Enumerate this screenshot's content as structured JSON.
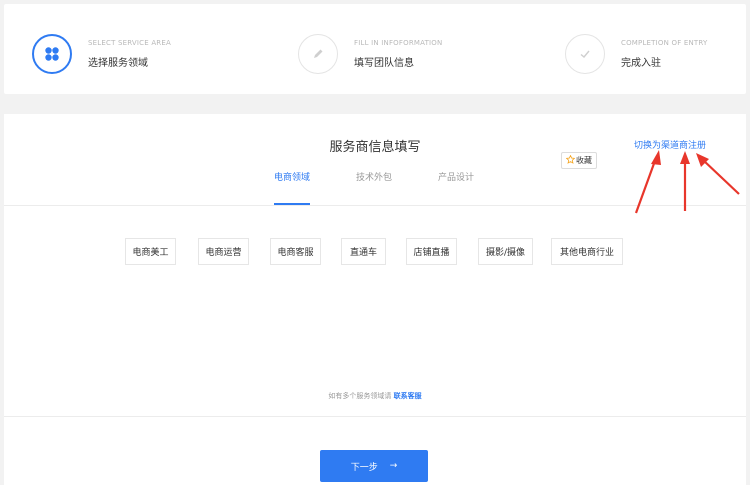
{
  "stepper": {
    "steps": [
      {
        "en": "SELECT SERVICE AREA",
        "zh": "选择服务领域",
        "icon": "grid-icon",
        "state": "active"
      },
      {
        "en": "FILL IN INFOFORMATION",
        "zh": "填写团队信息",
        "icon": "pencil-icon",
        "state": "pending"
      },
      {
        "en": "COMPLETION OF ENTRY",
        "zh": "完成入驻",
        "icon": "check-icon",
        "state": "pending"
      }
    ]
  },
  "form": {
    "title": "服务商信息填写",
    "channel_link": "切换为渠道商注册",
    "favorite_label": "收藏",
    "tabs": [
      {
        "label": "电商领域",
        "active": true
      },
      {
        "label": "技术外包",
        "active": false
      },
      {
        "label": "产品设计",
        "active": false
      }
    ],
    "categories": [
      "电商美工",
      "电商运营",
      "电商客服",
      "直通车",
      "店铺直播",
      "摄影/摄像",
      "其他电商行业"
    ],
    "hint_text": "如有多个服务领域请",
    "hint_link": "联系客服",
    "next_label": "下一步",
    "next_arrow": "→"
  },
  "colors": {
    "accent": "#2f7bf2",
    "annotation": "#e8362b",
    "star": "#f5a623"
  }
}
